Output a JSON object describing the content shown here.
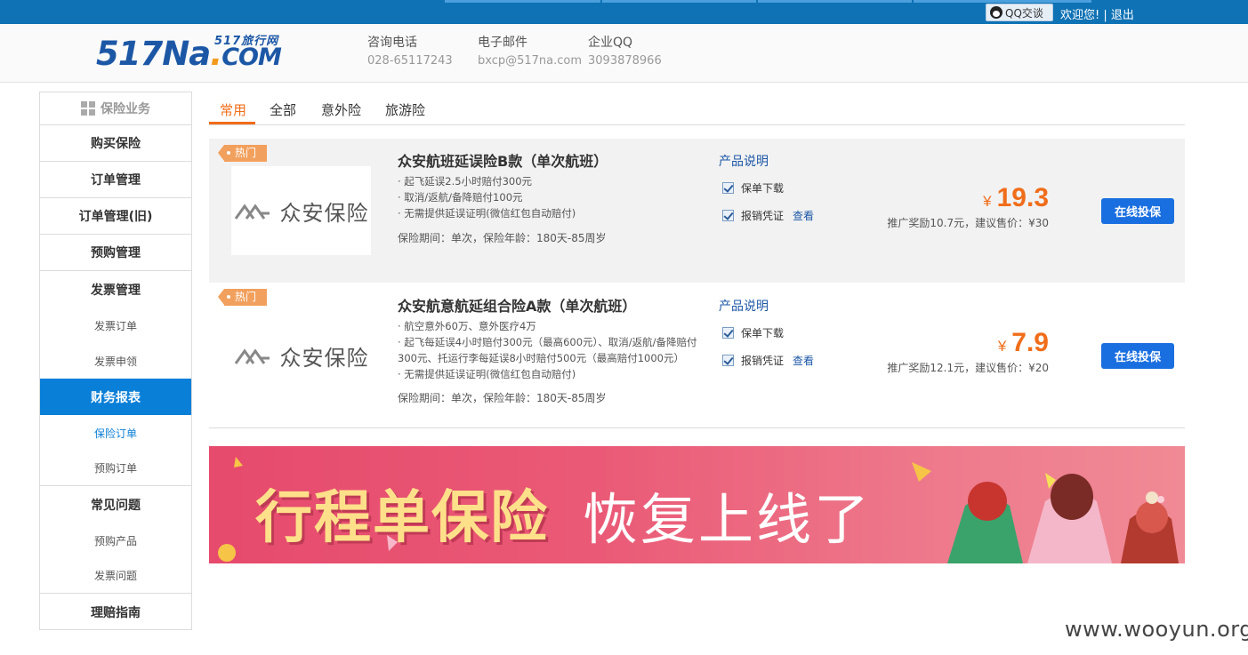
{
  "topbar": {
    "qq_label": "QQ交谈",
    "welcome": "欢迎您!",
    "separator": "|",
    "logout": "退出"
  },
  "header": {
    "logo_main": "517Na",
    "logo_dot": ".",
    "logo_com": "COM",
    "logo_sub": "517旅行网",
    "contacts": [
      {
        "label": "咨询电话",
        "value": "028-65117243"
      },
      {
        "label": "电子邮件",
        "value": "bxcp@517na.com"
      },
      {
        "label": "企业QQ",
        "value": "3093878966"
      }
    ]
  },
  "sidebar": {
    "head": "保险业务",
    "items": {
      "buy": "购买保险",
      "orders": "订单管理",
      "orders_old": "订单管理(旧)",
      "prebuy": "预购管理",
      "invoice": "发票管理",
      "invoice_orders": "发票订单",
      "invoice_apply": "发票申领",
      "finance": "财务报表",
      "ins_orders": "保险订单",
      "prebuy_orders": "预购订单",
      "faq": "常见问题",
      "prebuy_products": "预购产品",
      "invoice_issues": "发票问题",
      "claims": "理赔指南"
    }
  },
  "tabs": [
    "常用",
    "全部",
    "意外险",
    "旅游险"
  ],
  "products": [
    {
      "hot": "热门",
      "insurer": "众安保险",
      "title": "众安航班延误险B款（单次航班）",
      "features": [
        "·   起飞延误2.5小时赔付300元",
        "·   取消/返航/备降赔付100元",
        "·   无需提供延误证明(微信红包自动赔付)"
      ],
      "period": "保险期间：单次，保险年龄：180天-85周岁",
      "desc_label": "产品说明",
      "check1": "保单下载",
      "check2": "报销凭证",
      "view": "查看",
      "currency": "¥",
      "price": "19.3",
      "promo": "推广奖励10.7元，建议售价：¥30",
      "buy": "在线投保"
    },
    {
      "hot": "热门",
      "insurer": "众安保险",
      "title": "众安航意航延组合险A款（单次航班）",
      "features": [
        "·   航空意外60万、意外医疗4万",
        "·   起飞每延误4小时赔付300元（最高600元）、取消/返航/备降赔付300元、托运行李每延误8小时赔付500元（最高赔付1000元）",
        "·   无需提供延误证明(微信红包自动赔付)"
      ],
      "period": "保险期间：单次，保险年龄：180天-85周岁",
      "desc_label": "产品说明",
      "check1": "保单下载",
      "check2": "报销凭证",
      "view": "查看",
      "currency": "¥",
      "price": "7.9",
      "promo": "推广奖励12.1元，建议售价：¥20",
      "buy": "在线投保"
    }
  ],
  "banner": {
    "headline": "行程单保险",
    "tagline": "恢复上线了"
  },
  "watermark": "www.wooyun.org",
  "colors": {
    "topbar": "#0e72b5",
    "accent_orange": "#f06d1a",
    "sidebar_active": "#0a7fd8",
    "buy_button": "#1a6fe0",
    "banner": "#e64a6d"
  }
}
